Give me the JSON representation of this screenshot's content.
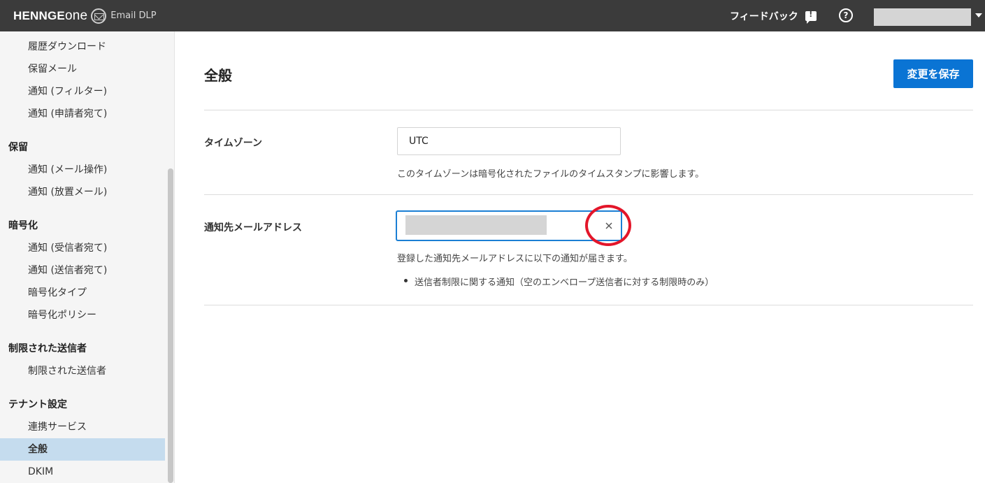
{
  "header": {
    "brand_main": "HENNGE",
    "brand_one": "one",
    "brand_product": "Email DLP",
    "feedback_label": "フィードバック",
    "help_glyph": "?",
    "icons": [
      "mail-icon",
      "feedback-icon",
      "help-icon",
      "chevron-down-icon"
    ]
  },
  "sidebar": {
    "groups": [
      {
        "heading": "",
        "items": [
          "履歴ダウンロード",
          "保留メール",
          "通知 (フィルター)",
          "通知 (申請者宛て)"
        ]
      },
      {
        "heading": "保留",
        "items": [
          "通知 (メール操作)",
          "通知 (放置メール)"
        ]
      },
      {
        "heading": "暗号化",
        "items": [
          "通知 (受信者宛て)",
          "通知 (送信者宛て)",
          "暗号化タイプ",
          "暗号化ポリシー"
        ]
      },
      {
        "heading": "制限された送信者",
        "items": [
          "制限された送信者"
        ]
      },
      {
        "heading": "テナント設定",
        "items": [
          "連携サービス",
          "全般",
          "DKIM"
        ]
      }
    ],
    "active_item": "全般"
  },
  "main": {
    "title": "全般",
    "save_label": "変更を保存",
    "timezone": {
      "label": "タイムゾーン",
      "value": "UTC",
      "help": "このタイムゾーンは暗号化されたファイルのタイムスタンプに影響します。"
    },
    "notify_email": {
      "label": "通知先メールアドレス",
      "value": "",
      "help": "登録した通知先メールアドレスに以下の通知が届きます。",
      "bullets": [
        "送信者制限に関する通知（空のエンベロープ送信者に対する制限時のみ）"
      ]
    }
  },
  "colors": {
    "topbar": "#3b3b3b",
    "accent": "#0a74d4",
    "active_nav": "#c5dcee",
    "highlight": "#e3162a"
  }
}
